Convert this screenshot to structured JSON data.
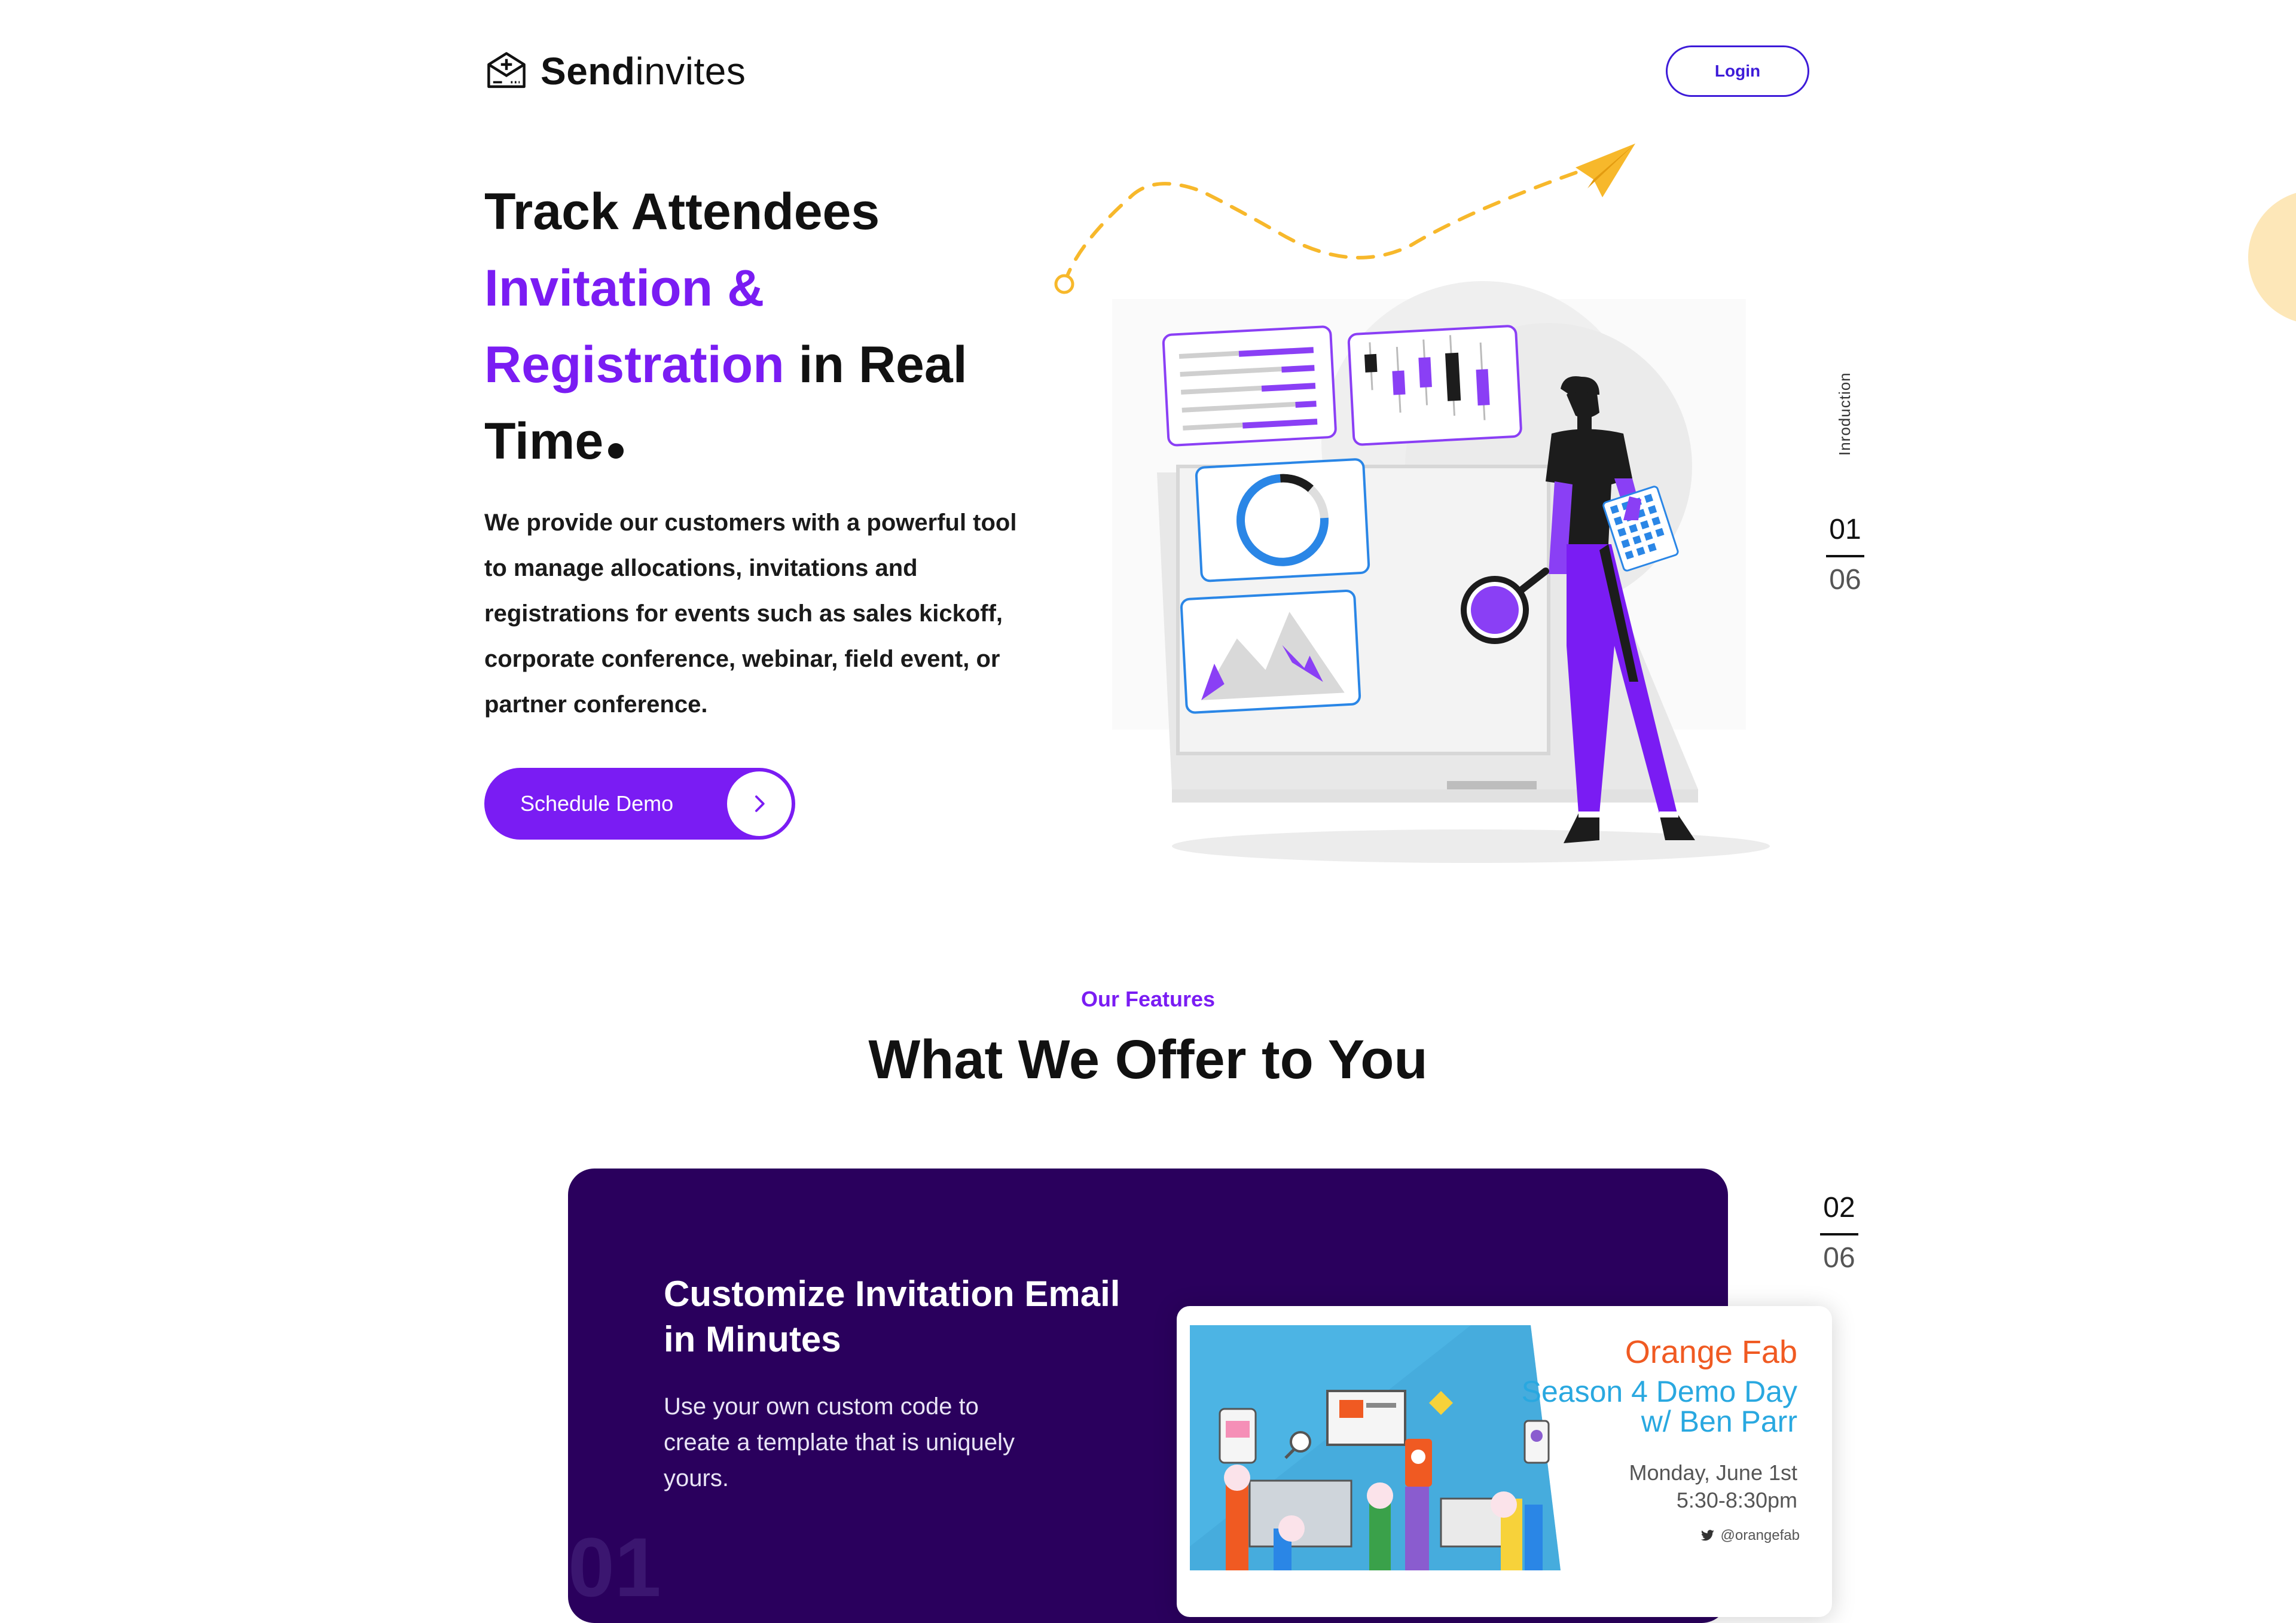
{
  "brand": {
    "name_bold": "Send",
    "name_regular": "invites"
  },
  "header": {
    "login_label": "Login"
  },
  "hero": {
    "title_line1": "Track Attendees",
    "title_accent1": "Invitation &",
    "title_accent2": "Registration",
    "title_rest": " in Real",
    "title_line4": "Time",
    "description": "We provide our customers with a powerful tool to manage allocations, invitations and registrations for events such as sales kickoff, corporate conference, webinar, field event, or partner conference.",
    "cta_label": "Schedule Demo"
  },
  "side_nav": {
    "section_label": "Inroduction",
    "current": "01",
    "total": "06"
  },
  "features": {
    "label": "Our Features",
    "title": "What We Offer to You",
    "counter_current": "02",
    "counter_total": "06",
    "card": {
      "title": "Customize Invitation Email in Minutes",
      "description": "Use your own custom code to create a template that is uniquely yours.",
      "ghost_number": "01"
    },
    "email_preview": {
      "org": "Orange Fab",
      "season_line1": "Season 4 Demo Day",
      "season_line2": "w/ Ben Parr",
      "date_line1": "Monday, June 1st",
      "date_line2": "5:30-8:30pm",
      "handle": "@orangefab"
    }
  },
  "colors": {
    "accent_purple": "#7a1cf3",
    "login_blue": "#3d1bd8",
    "card_bg": "#2a005d",
    "yellow": "#f7b82b",
    "orange": "#f05a22",
    "sky": "#29a8e0"
  },
  "icons": [
    "envelope-logo-icon",
    "chevron-right-icon",
    "paper-plane-icon",
    "twitter-icon"
  ]
}
